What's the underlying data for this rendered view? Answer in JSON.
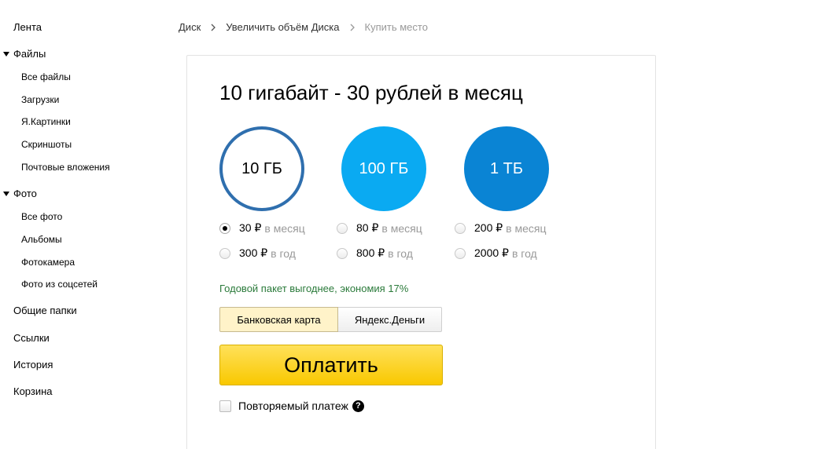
{
  "sidebar": {
    "feed": "Лента",
    "files": {
      "label": "Файлы",
      "items": [
        "Все файлы",
        "Загрузки",
        "Я.Картинки",
        "Скриншоты",
        "Почтовые вложения"
      ]
    },
    "photo": {
      "label": "Фото",
      "items": [
        "Все фото",
        "Альбомы",
        "Фотокамера",
        "Фото из соцсетей"
      ]
    },
    "shared": "Общие папки",
    "links": "Ссылки",
    "history": "История",
    "trash": "Корзина"
  },
  "breadcrumb": {
    "disk": "Диск",
    "increase": "Увеличить объём Диска",
    "current": "Купить место"
  },
  "card": {
    "title": "10 гигабайт - 30 рублей в месяц",
    "plans": [
      {
        "label": "10 ГБ",
        "selected": true,
        "color": "#2f6fae",
        "monthly": {
          "price": "30 ₽",
          "period": "в месяц",
          "checked": true
        },
        "yearly": {
          "price": "300 ₽",
          "period": "в год",
          "checked": false
        }
      },
      {
        "label": "100 ГБ",
        "selected": false,
        "color": "#0aaaf2",
        "monthly": {
          "price": "80 ₽",
          "period": "в месяц",
          "checked": false
        },
        "yearly": {
          "price": "800 ₽",
          "period": "в год",
          "checked": false
        }
      },
      {
        "label": "1 ТБ",
        "selected": false,
        "color": "#0a84d4",
        "monthly": {
          "price": "200 ₽",
          "period": "в месяц",
          "checked": false
        },
        "yearly": {
          "price": "2000 ₽",
          "period": "в год",
          "checked": false
        }
      }
    ],
    "saving_note": "Годовой пакет выгоднее, экономия 17%",
    "payment_methods": {
      "card": "Банковская карта",
      "yandex_money": "Яндекс.Деньги",
      "active": "card"
    },
    "pay_button": "Оплатить",
    "recurring": {
      "label": "Повторяемый платеж",
      "checked": false,
      "help_icon": "question-circle-icon"
    }
  },
  "colors": {
    "accent_yellow": "#f9c800",
    "saving_green": "#2a7a3a",
    "selected_ring": "#2f6fae"
  }
}
